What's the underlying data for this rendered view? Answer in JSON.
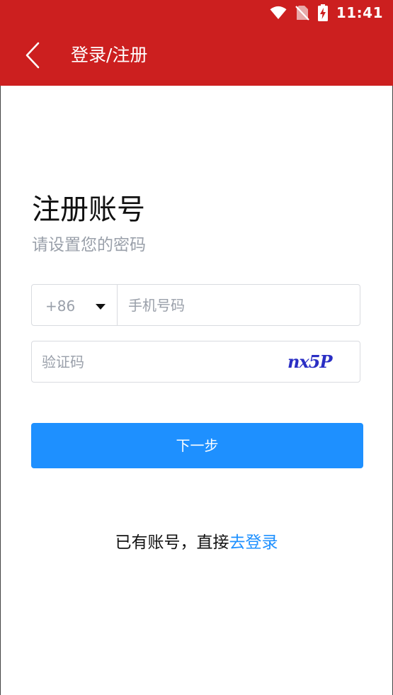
{
  "status_bar": {
    "time": "11:41",
    "icons": [
      "wifi-icon",
      "no-sim-icon",
      "battery-charging-icon"
    ]
  },
  "header": {
    "title": "登录/注册",
    "back_icon": "chevron-left-icon",
    "background_color": "#cc1f1f"
  },
  "form": {
    "heading": "注册账号",
    "subheading": "请设置您的密码",
    "country_code": "+86",
    "phone_placeholder": "手机号码",
    "captcha_placeholder": "验证码",
    "captcha_text": "nx5P",
    "next_button_label": "下一步",
    "accent_color": "#1e90ff"
  },
  "footer": {
    "prompt_text": "已有账号，直接",
    "login_link_label": "去登录"
  }
}
